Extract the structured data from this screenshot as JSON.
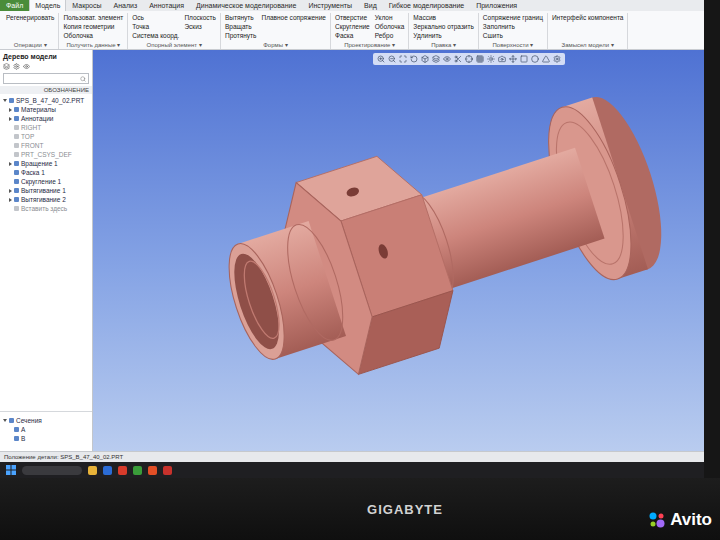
{
  "ribbon": {
    "file_tab": "Файл",
    "tabs": [
      {
        "label": "Модель",
        "selected": true
      },
      {
        "label": "Макросы",
        "selected": false
      },
      {
        "label": "Анализ",
        "selected": false
      },
      {
        "label": "Аннотация",
        "selected": false
      },
      {
        "label": "Динамическое моделирование",
        "selected": false
      },
      {
        "label": "Инструменты",
        "selected": false
      },
      {
        "label": "Вид",
        "selected": false
      },
      {
        "label": "Гибкое моделирование",
        "selected": false
      },
      {
        "label": "Приложения",
        "selected": false
      }
    ],
    "groups": [
      {
        "label": "Операции ▾",
        "items": [
          "Регенерировать"
        ]
      },
      {
        "label": "Получить данные ▾",
        "items": [
          "Пользоват. элемент",
          "Копия геометрии",
          "Оболочка"
        ]
      },
      {
        "label": "Опорный элемент ▾",
        "items": [
          "Ось",
          "Точка",
          "Система коорд.",
          "Плоскость",
          "Эскиз"
        ]
      },
      {
        "label": "Формы ▾",
        "items": [
          "Вытянуть",
          "Вращать",
          "Протянуть",
          "Плавное сопряжение"
        ]
      },
      {
        "label": "Проектирование ▾",
        "items": [
          "Отверстие",
          "Скругление",
          "Фаска",
          "Уклон",
          "Оболочка",
          "Ребро"
        ]
      },
      {
        "label": "Правка ▾",
        "items": [
          "Массив",
          "Зеркально отразить",
          "Удлинить"
        ]
      },
      {
        "label": "Поверхности ▾",
        "items": [
          "Сопряжение границ",
          "Заполнить",
          "Сшить"
        ]
      },
      {
        "label": "Замысел модели ▾",
        "items": [
          "Интерфейс компонента"
        ]
      }
    ]
  },
  "tree": {
    "title": "Дерево модели",
    "column": "ОБОЗНАЧЕНИЕ",
    "items": [
      {
        "label": "SPS_B_47_40_02.PRT",
        "depth": 0,
        "greyed": false,
        "expandable": true,
        "expanded": true
      },
      {
        "label": "Материалы",
        "depth": 1,
        "greyed": false,
        "expandable": true,
        "expanded": false
      },
      {
        "label": "Аннотации",
        "depth": 1,
        "greyed": false,
        "expandable": true,
        "expanded": false
      },
      {
        "label": "RIGHT",
        "depth": 1,
        "greyed": true,
        "expandable": false,
        "expanded": false
      },
      {
        "label": "TOP",
        "depth": 1,
        "greyed": true,
        "expandable": false,
        "expanded": false
      },
      {
        "label": "FRONT",
        "depth": 1,
        "greyed": true,
        "expandable": false,
        "expanded": false
      },
      {
        "label": "PRT_CSYS_DEF",
        "depth": 1,
        "greyed": true,
        "expandable": false,
        "expanded": false
      },
      {
        "label": "Вращение 1",
        "depth": 1,
        "greyed": false,
        "expandable": true,
        "expanded": false
      },
      {
        "label": "Фаска 1",
        "depth": 1,
        "greyed": false,
        "expandable": false,
        "expanded": false
      },
      {
        "label": "Скругление 1",
        "depth": 1,
        "greyed": false,
        "expandable": false,
        "expanded": false
      },
      {
        "label": "Вытягивание 1",
        "depth": 1,
        "greyed": false,
        "expandable": true,
        "expanded": false
      },
      {
        "label": "Вытягивание 2",
        "depth": 1,
        "greyed": false,
        "expandable": true,
        "expanded": false
      },
      {
        "label": "Вставить здесь",
        "depth": 1,
        "greyed": true,
        "expandable": false,
        "expanded": false
      }
    ],
    "sections": [
      {
        "label": "Сечения",
        "depth": 0,
        "greyed": false,
        "expandable": true,
        "expanded": true
      },
      {
        "label": "A",
        "depth": 1,
        "greyed": false,
        "expandable": false,
        "expanded": false
      },
      {
        "label": "B",
        "depth": 1,
        "greyed": false,
        "expandable": false,
        "expanded": false
      }
    ]
  },
  "status_bar": "Положение детали: SPS_B_47_40_02.PRT",
  "taskbar": {
    "apps": [
      {
        "color": "#e8b339"
      },
      {
        "color": "#2b6cd6"
      },
      {
        "color": "#d83b2b"
      },
      {
        "color": "#3a9d3a"
      },
      {
        "color": "#e34f26"
      },
      {
        "color": "#c8322c"
      }
    ]
  },
  "monitor": {
    "brand": "GIGABYTE"
  },
  "watermark": "Avito"
}
